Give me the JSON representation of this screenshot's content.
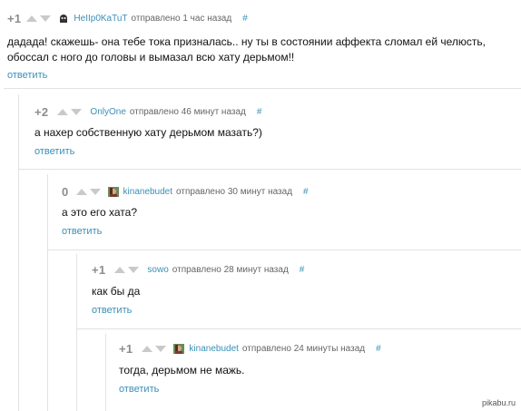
{
  "comments": [
    {
      "rating": "+1",
      "author": "HeIIp0KaTuT",
      "sent": "отправлено 1 час назад",
      "hash": "#",
      "lines": [
        "дадада! скажешь- она тебе тока призналась.. ну ты в состоянии аффекта сломал ей челюсть,",
        "обоссал с ного до головы и вымазал всю хату дерьмом!!"
      ],
      "reply": "ответить",
      "avatar": "ghost-avatar"
    },
    {
      "rating": "+2",
      "author": "OnlyOne",
      "sent": "отправлено 46 минут назад",
      "hash": "#",
      "lines": [
        "а нахер собственную хату дерьмом мазать?)"
      ],
      "reply": "ответить",
      "avatar": ""
    },
    {
      "rating": "0",
      "author": "kinanebudet",
      "sent": "отправлено 30 минут назад",
      "hash": "#",
      "lines": [
        "а это его хата?"
      ],
      "reply": "ответить",
      "avatar": "photo-avatar"
    },
    {
      "rating": "+1",
      "author": "sowo",
      "sent": "отправлено 28 минут назад",
      "hash": "#",
      "lines": [
        "как бы да"
      ],
      "reply": "ответить",
      "avatar": ""
    },
    {
      "rating": "+1",
      "author": "kinanebudet",
      "sent": "отправлено 24 минуты назад",
      "hash": "#",
      "lines": [
        "тогда, дерьмом не мажь."
      ],
      "reply": "ответить",
      "avatar": "photo-avatar"
    }
  ],
  "watermark": "pikabu.ru",
  "colors": {
    "link": "#3a8fb7",
    "rating": "#8c8c8c",
    "arrow": "#c9c9c9",
    "thread_line": "#e2e2e2"
  }
}
